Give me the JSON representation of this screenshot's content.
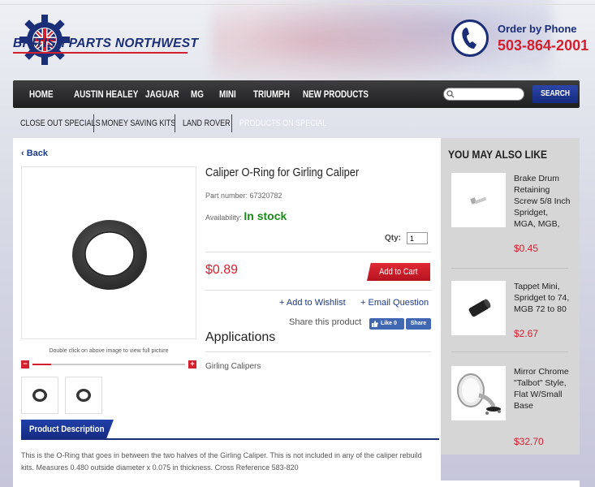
{
  "header": {
    "brand": "BRITISH PARTS NORTHWEST",
    "phone_label": "Order by Phone",
    "phone_number": "503-864-2001"
  },
  "nav": {
    "items": [
      "HOME",
      "AUSTIN HEALEY",
      "JAGUAR",
      "MG",
      "MINI",
      "TRIUMPH",
      "NEW PRODUCTS"
    ],
    "search_placeholder": "",
    "search_button": "SEARCH"
  },
  "subnav": {
    "items": [
      "CLOSE OUT SPECIALS",
      "MONEY SAVING KITS",
      "LAND ROVER",
      "PRODUCTS ON SPECIAL"
    ]
  },
  "product": {
    "back": "‹ Back",
    "title": "Caliper O-Ring for Girling Caliper",
    "part_number": "Part number: 67320782",
    "availability_label": "Availability:",
    "availability_value": "In stock",
    "qty_label": "Qty:",
    "qty_value": "1",
    "price": "$0.89",
    "add_to_cart": "Add to Cart",
    "add_to_wishlist": "+ Add to Wishlist",
    "email_question": "+ Email Question",
    "share_label": "Share this product",
    "fb_like": "Like 0",
    "fb_share": "Share",
    "image_hint": "Double click on above image to view full picture",
    "zoom_level": 0.12,
    "applications_title": "Applications",
    "applications": [
      "Girling Calipers"
    ],
    "description_tab": "Product Description",
    "description": "This is the O-Ring that goes in between the two halves of the Girling Caliper. This is not included in any of the caliper rebuild kits. Measures 0.480 outside diameter x 0.075 in thickness. Cross Reference 583-820"
  },
  "sidebar": {
    "title": "YOU MAY ALSO LIKE",
    "items": [
      {
        "name": "Brake Drum Retaining Screw 5/8 Inch Spridget, MGA, MGB,",
        "price": "$0.45",
        "icon": "screw-icon"
      },
      {
        "name": "Tappet Mini, Spridget to 74, MGB 72 to 80",
        "price": "$2.67",
        "icon": "tappet-icon"
      },
      {
        "name": "Mirror Chrome \"Talbot\" Style, Flat W/Small Base",
        "price": "$32.70",
        "icon": "mirror-icon"
      }
    ]
  },
  "colors": {
    "brand_blue": "#1b2e78",
    "brand_red": "#d3202f",
    "stock_green": "#1a8a1a"
  }
}
